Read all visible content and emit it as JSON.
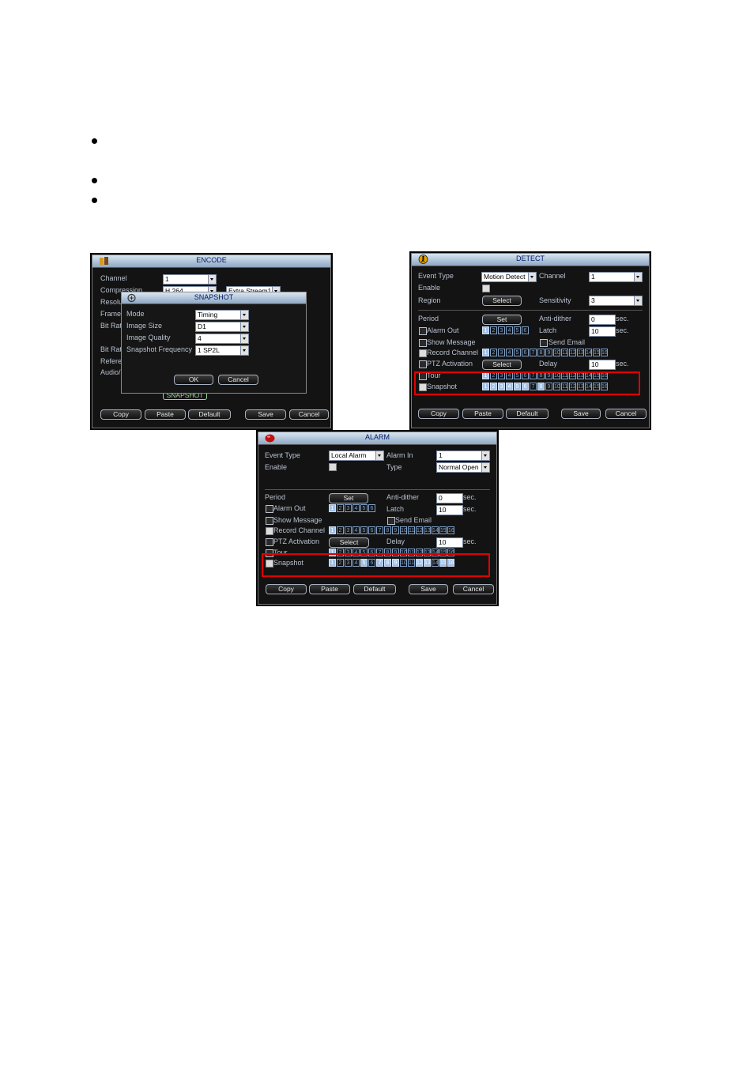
{
  "encode": {
    "title": "ENCODE",
    "labels": [
      "Channel",
      "Compression",
      "Resolu",
      "Frame",
      "Bit Rate",
      "Bit Rate",
      "Refere",
      "Audio/"
    ],
    "channel_value": "1",
    "compression_value": "H.264",
    "extra_stream_value": "Extra Stream1",
    "snapshot_button": "SNAPSHOT",
    "buttons": [
      "Copy",
      "Paste",
      "Default",
      "Save",
      "Cancel"
    ]
  },
  "snapshot": {
    "title": "SNAPSHOT",
    "labels": [
      "Mode",
      "Image Size",
      "Image Quality",
      "Snapshot Frequency"
    ],
    "values": [
      "Timing",
      "D1",
      "4",
      "1 SP2L"
    ],
    "ok": "OK",
    "cancel": "Cancel"
  },
  "detect": {
    "title": "DETECT",
    "event_type_label": "Event Type",
    "event_type_value": "Motion Detect",
    "channel_label": "Channel",
    "channel_value": "1",
    "enable_label": "Enable",
    "region_label": "Region",
    "region_button": "Select",
    "sensitivity_label": "Sensitivity",
    "sensitivity_value": "3",
    "period_label": "Period",
    "period_button": "Set",
    "anti_dither_label": "Anti-dither",
    "anti_dither_value": "0",
    "latch_label": "Latch",
    "latch_value": "10",
    "delay_label": "Delay",
    "delay_value": "10",
    "sec": "sec.",
    "alarm_out_label": "Alarm Out",
    "show_message_label": "Show Message",
    "send_email_label": "Send Email",
    "record_channel_label": "Record Channel",
    "ptz_label": "PTZ Activation",
    "ptz_button": "Select",
    "tour_label": "Tour",
    "snapshot_label": "Snapshot",
    "buttons": [
      "Copy",
      "Paste",
      "Default",
      "Save",
      "Cancel"
    ]
  },
  "alarm": {
    "title": "ALARM",
    "event_type_label": "Event Type",
    "event_type_value": "Local Alarm",
    "alarm_in_label": "Alarm In",
    "alarm_in_value": "1",
    "enable_label": "Enable",
    "type_label": "Type",
    "type_value": "Normal Open",
    "period_label": "Period",
    "period_button": "Set",
    "anti_dither_label": "Anti-dither",
    "anti_dither_value": "0",
    "latch_label": "Latch",
    "latch_value": "10",
    "delay_label": "Delay",
    "delay_value": "10",
    "sec": "sec.",
    "alarm_out_label": "Alarm Out",
    "show_message_label": "Show Message",
    "send_email_label": "Send Email",
    "record_channel_label": "Record Channel",
    "ptz_label": "PTZ Activation",
    "ptz_button": "Select",
    "tour_label": "Tour",
    "snapshot_label": "Snapshot",
    "buttons": [
      "Copy",
      "Paste",
      "Default",
      "Save",
      "Cancel"
    ]
  },
  "channel_numbers": [
    "1",
    "2",
    "3",
    "4",
    "5",
    "6",
    "7",
    "8",
    "9",
    "10",
    "11",
    "12",
    "13",
    "14",
    "15",
    "16"
  ],
  "alarm_out_numbers": [
    "1",
    "2",
    "3",
    "4",
    "5",
    "6"
  ],
  "colors": {
    "highlight_box": "#e00000",
    "window_bg": "#131313",
    "title_text": "#001a66"
  }
}
